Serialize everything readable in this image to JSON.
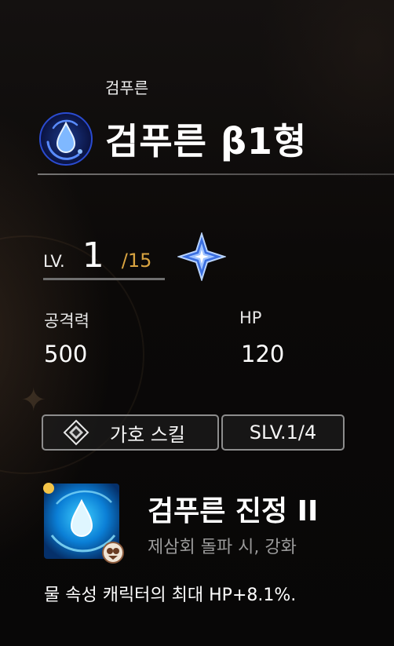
{
  "header": {
    "subtitle": "검푸른",
    "title": "검푸른 β1형",
    "element_icon": "water-drop-icon"
  },
  "level": {
    "label": "LV.",
    "value": "1",
    "max": "/15",
    "rank_icon": "star-rank-icon"
  },
  "stats": [
    {
      "label": "공격력",
      "value": "500"
    },
    {
      "label": "HP",
      "value": "120"
    }
  ],
  "skill_tag": {
    "icon": "protection-icon",
    "label": "가호 스킬",
    "level": "SLV.1/4"
  },
  "skill": {
    "icon": "water-drop-skill-icon",
    "name": "검푸른 진정 II",
    "condition": "제삼회 돌파 시, 강화",
    "description": "물 속성 캐릭터의 최대 HP+8.1%."
  },
  "colors": {
    "accent_gold": "#d9a441",
    "water_blue": "#3fb6ff",
    "border_gray": "#8d8d8d"
  }
}
